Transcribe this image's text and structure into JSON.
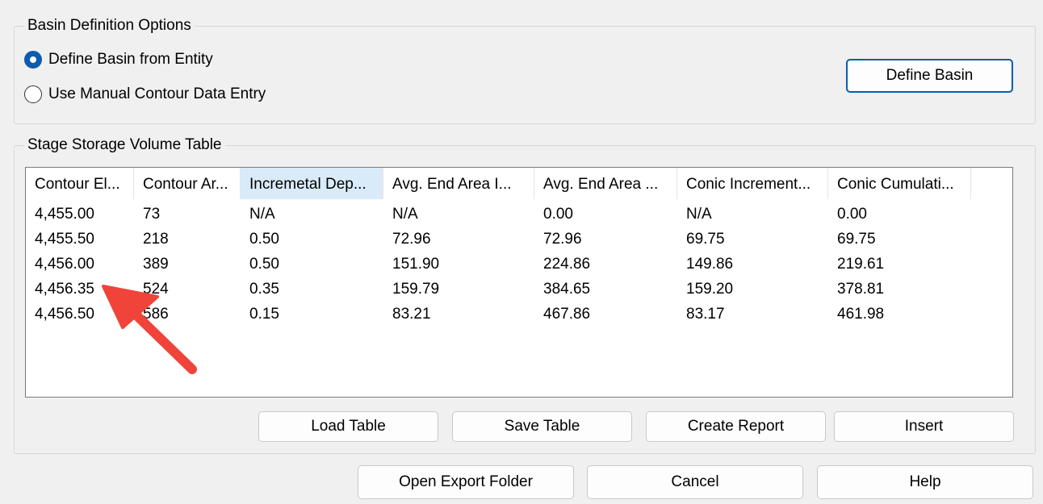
{
  "basin_options": {
    "title": "Basin Definition Options",
    "radio_entity": "Define Basin from Entity",
    "radio_manual": "Use Manual Contour Data Entry",
    "selected": "Define Basin from Entity",
    "define_basin_button": "Define Basin"
  },
  "stage_table": {
    "title": "Stage Storage Volume Table",
    "columns": [
      "Contour El...",
      "Contour Ar...",
      "Incremetal Dep...",
      "Avg. End Area I...",
      "Avg. End Area ...",
      "Conic Increment...",
      "Conic Cumulati..."
    ],
    "rows": [
      [
        "4,455.00",
        "73",
        "N/A",
        "N/A",
        "0.00",
        "N/A",
        "0.00"
      ],
      [
        "4,455.50",
        "218",
        "0.50",
        "72.96",
        "72.96",
        "69.75",
        "69.75"
      ],
      [
        "4,456.00",
        "389",
        "0.50",
        "151.90",
        "224.86",
        "149.86",
        "219.61"
      ],
      [
        "4,456.35",
        "524",
        "0.35",
        "159.79",
        "384.65",
        "159.20",
        "378.81"
      ],
      [
        "4,456.50",
        "586",
        "0.15",
        "83.21",
        "467.86",
        "83.17",
        "461.98"
      ]
    ],
    "sorted_column": "Incremetal Dep...",
    "buttons": {
      "load": "Load Table",
      "save": "Save Table",
      "report": "Create Report",
      "insert": "Insert"
    }
  },
  "footer": {
    "open_export": "Open Export Folder",
    "cancel": "Cancel",
    "help": "Help"
  },
  "annotation": {
    "arrow_color": "#f0443a"
  },
  "colors": {
    "accent": "#0b5cad",
    "header_highlight": "#d9ebf9"
  }
}
